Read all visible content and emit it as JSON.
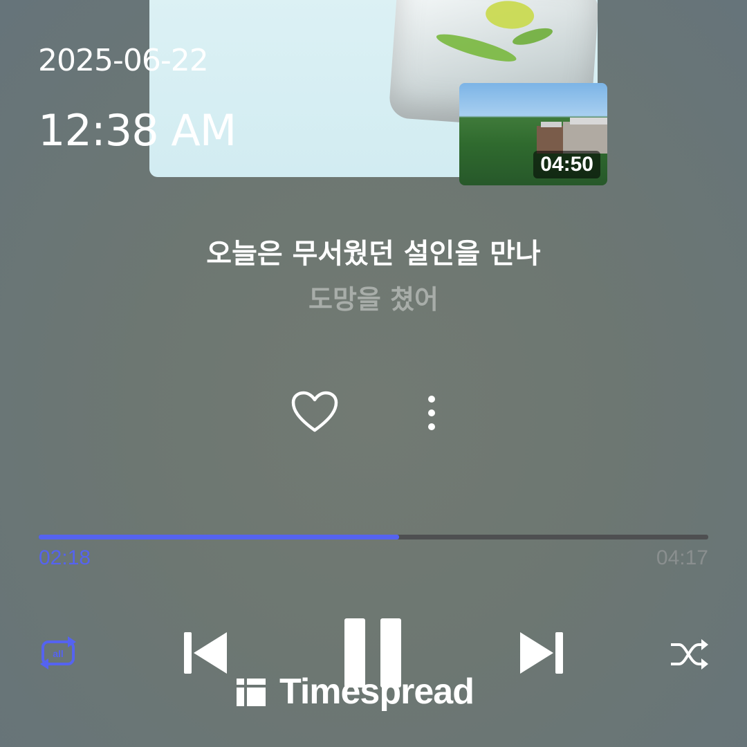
{
  "status": {
    "date": "2025-06-22",
    "time": "12:38 AM"
  },
  "video_thumbnail": {
    "duration": "04:50"
  },
  "track": {
    "title": "오늘은 무서웠던 설인을 만나",
    "artist": "도망을 쳤어",
    "liked": false
  },
  "icons": {
    "like": "heart-icon",
    "more": "more-vertical-icon",
    "repeat": "repeat-all-icon",
    "previous": "skip-previous-icon",
    "pause": "pause-icon",
    "next": "skip-next-icon",
    "shuffle": "shuffle-icon"
  },
  "playback": {
    "elapsed": "02:18",
    "total": "04:17",
    "progress_fraction": 0.538,
    "repeat_mode": "all",
    "state": "playing"
  },
  "colors": {
    "accent": "#5563f0",
    "background": "#6d7772",
    "artist_text": "#a8ada9",
    "progress_track": "#4e4f51"
  },
  "watermark": {
    "text": "Timespread"
  }
}
